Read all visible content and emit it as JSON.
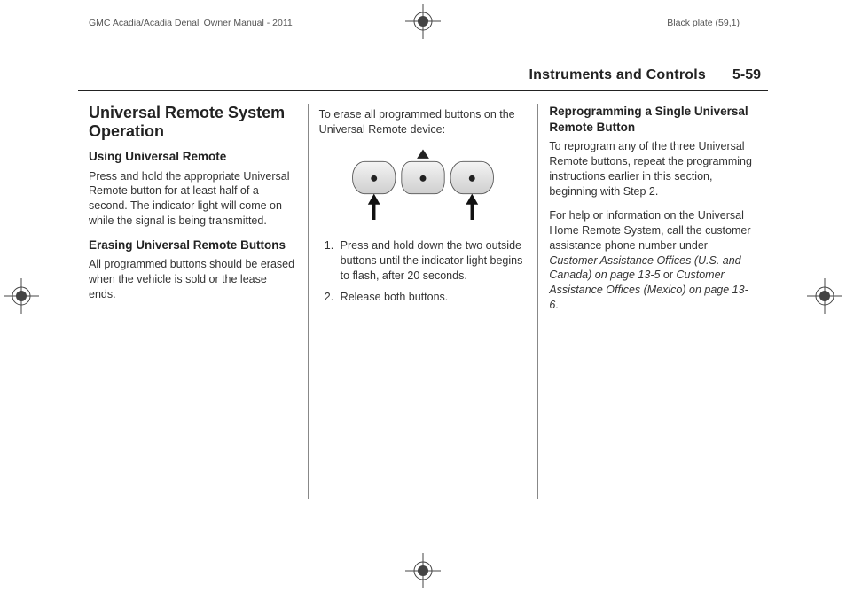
{
  "meta": {
    "doc_title": "GMC Acadia/Acadia Denali Owner Manual - 2011",
    "plate": "Black plate (59,1)"
  },
  "header": {
    "section": "Instruments and Controls",
    "page": "5-59"
  },
  "col1": {
    "h2": "Universal Remote System Operation",
    "sub1": "Using Universal Remote",
    "p1": "Press and hold the appropriate Universal Remote button for at least half of a second. The indicator light will come on while the signal is being transmitted.",
    "sub2": "Erasing Universal Remote Buttons",
    "p2": "All programmed buttons should be erased when the vehicle is sold or the lease ends."
  },
  "col2": {
    "intro": "To erase all programmed buttons on the Universal Remote device:",
    "step1": "Press and hold down the two outside buttons until the indicator light begins to flash, after 20 seconds.",
    "step2": "Release both buttons."
  },
  "col3": {
    "sub1": "Reprogramming a Single Universal Remote Button",
    "p1": "To reprogram any of the three Universal Remote buttons, repeat the programming instructions earlier in this section, beginning with Step 2.",
    "p2a": "For help or information on the Universal Home Remote System, call the customer assistance phone number under ",
    "ref1": "Customer Assistance Offices (U.S. and Canada) on page 13-5",
    "p2b": " or ",
    "ref2": "Customer Assistance Offices (Mexico) on page 13-6",
    "p2c": "."
  }
}
